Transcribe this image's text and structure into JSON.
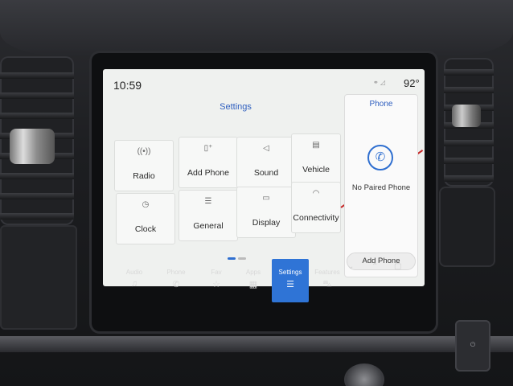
{
  "status_bar": {
    "time": "10:59",
    "temperature": "92°",
    "icons": [
      "bluetooth-off-icon",
      "signal-off-icon"
    ]
  },
  "settings": {
    "title": "Settings",
    "tiles": [
      {
        "label": "Radio",
        "icon": "radio-antenna-icon"
      },
      {
        "label": "Add Phone",
        "icon": "phone-add-icon"
      },
      {
        "label": "Sound",
        "icon": "speaker-icon"
      },
      {
        "label": "Vehicle",
        "icon": "vehicle-icon"
      },
      {
        "label": "Clock",
        "icon": "clock-icon"
      },
      {
        "label": "General",
        "icon": "sliders-icon"
      },
      {
        "label": "Display",
        "icon": "display-icon"
      },
      {
        "label": "Connectivity",
        "icon": "wifi-icon"
      }
    ]
  },
  "phone_panel": {
    "title": "Phone",
    "message": "No Paired Phone",
    "button": "Add Phone",
    "icon": "phone-icon"
  },
  "feature_bar": {
    "items": [
      {
        "label": "Audio",
        "icon": "music-note-icon",
        "active": false
      },
      {
        "label": "Phone",
        "icon": "phone-icon",
        "active": false
      },
      {
        "label": "Fav",
        "icon": "star-icon",
        "active": false
      },
      {
        "label": "Apps",
        "icon": "grid-icon",
        "active": false
      },
      {
        "label": "Settings",
        "icon": "sliders-icon",
        "active": true
      },
      {
        "label": "Features",
        "icon": "car-icon",
        "active": false
      }
    ],
    "extra_icons": [
      "chevron-down-icon",
      "chevron-up-icon",
      "square-icon"
    ]
  },
  "colors": {
    "accent": "#2f74d6",
    "crossout": "#c62828",
    "screen_bg": "#eff1ef"
  }
}
